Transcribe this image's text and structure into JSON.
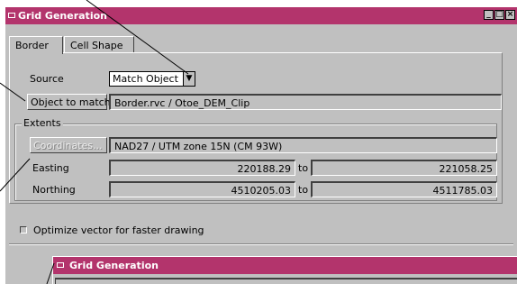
{
  "window": {
    "title": "Grid Generation"
  },
  "tabs": [
    {
      "label": "Border",
      "active": true
    },
    {
      "label": "Cell Shape",
      "active": false
    }
  ],
  "border": {
    "source_label": "Source",
    "source_value": "Match Object",
    "object_button": "Object to match",
    "object_value": "Border.rvc / Otoe_DEM_Clip",
    "extents_label": "Extents",
    "coordinates_button": "Coordinates...",
    "coordinates_value": "NAD27 / UTM zone 15N (CM 93W)",
    "easting_label": "Easting",
    "easting_min": "220188.29",
    "easting_max": "221058.25",
    "northing_label": "Northing",
    "northing_min": "4510205.03",
    "northing_max": "4511785.03",
    "to_label": "to"
  },
  "optimize": {
    "label": "Optimize vector for faster drawing",
    "checked": false
  },
  "dialog2": {
    "title": "Grid Generation"
  }
}
